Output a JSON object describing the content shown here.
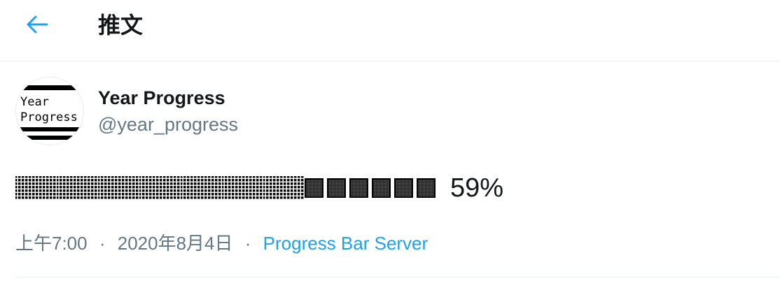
{
  "header": {
    "title": "推文",
    "back_icon": "arrow-left-icon",
    "accent_color": "#1da1f2"
  },
  "tweet": {
    "avatar": {
      "line1": "Year",
      "line2": "Progress"
    },
    "author": {
      "name": "Year Progress",
      "handle": "@year_progress"
    },
    "progress": {
      "percent_text": "59%",
      "filled_fraction": 0.59
    },
    "meta": {
      "time": "上午7:00",
      "date": "2020年8月4日",
      "separator": "·",
      "source": "Progress Bar Server"
    }
  },
  "colors": {
    "text_primary": "#14171a",
    "text_secondary": "#657786",
    "link": "#1da1f2",
    "border": "#e6ecf0"
  }
}
